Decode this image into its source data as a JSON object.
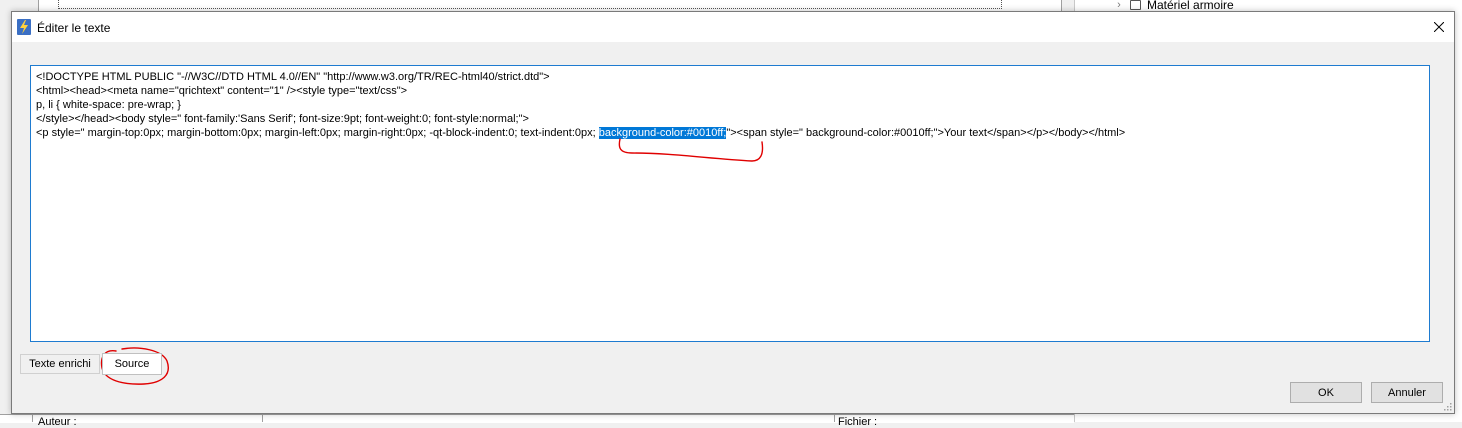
{
  "background": {
    "tree_item_label": "Matériel armoire",
    "bottom_left_label": "Auteur :",
    "bottom_right_label": "Fichier :"
  },
  "dialog": {
    "title": "Éditer le texte",
    "source_lines": [
      "<!DOCTYPE HTML PUBLIC \"-//W3C//DTD HTML 4.0//EN\" \"http://www.w3.org/TR/REC-html40/strict.dtd\">",
      "<html><head><meta name=\"qrichtext\" content=\"1\" /><style type=\"text/css\">",
      "p, li { white-space: pre-wrap; }",
      "</style></head><body style=\" font-family:'Sans Serif'; font-size:9pt; font-weight:0; font-style:normal;\">"
    ],
    "source_last_line": {
      "before": "<p style=\" margin-top:0px; margin-bottom:0px; margin-left:0px; margin-right:0px; -qt-block-indent:0; text-indent:0px; ",
      "selected": "background-color:#0010ff;",
      "after": "\"><span style=\" background-color:#0010ff;\">Your text</span></p></body></html>"
    },
    "tabs": {
      "rich_text": "Texte enrichi",
      "source": "Source"
    },
    "buttons": {
      "ok": "OK",
      "cancel": "Annuler"
    }
  },
  "colors": {
    "selection": "#0078d7",
    "editor_border": "#1e7bd0",
    "annotation": "#e00000"
  }
}
